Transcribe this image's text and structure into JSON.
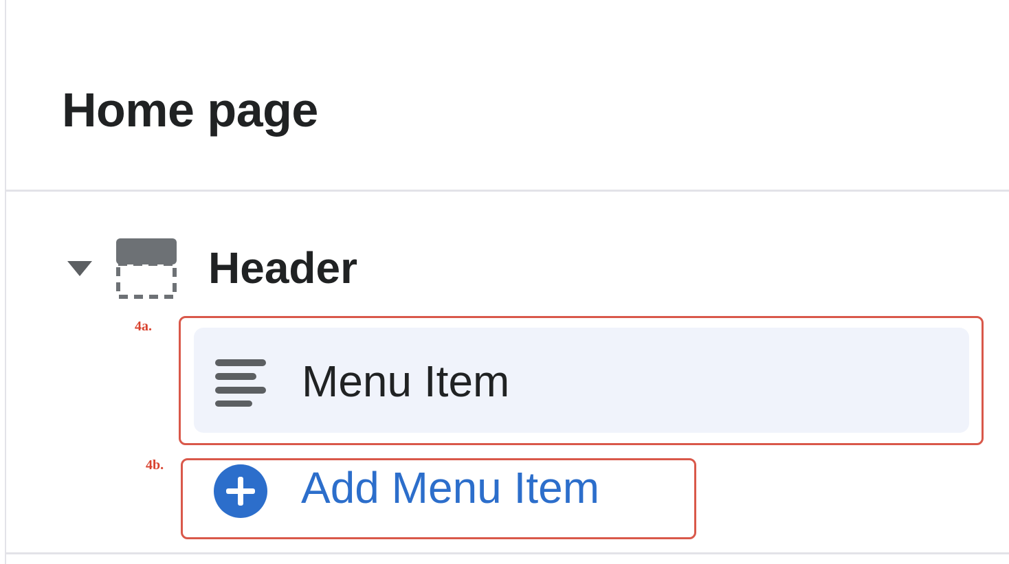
{
  "page": {
    "title": "Home page"
  },
  "section": {
    "title": "Header",
    "expanded": true,
    "icon": "header-section-icon"
  },
  "menu_item": {
    "label": "Menu Item",
    "icon": "text-align-left-icon"
  },
  "add_item": {
    "label": "Add Menu Item",
    "icon": "plus-circle-icon"
  },
  "annotations": {
    "a": "4a.",
    "b": "4b."
  },
  "colors": {
    "text": "#202223",
    "link": "#2c6ecb",
    "selected_bg": "#f0f3fb",
    "annotation": "#d9432f",
    "icon_gray": "#6d7175"
  }
}
